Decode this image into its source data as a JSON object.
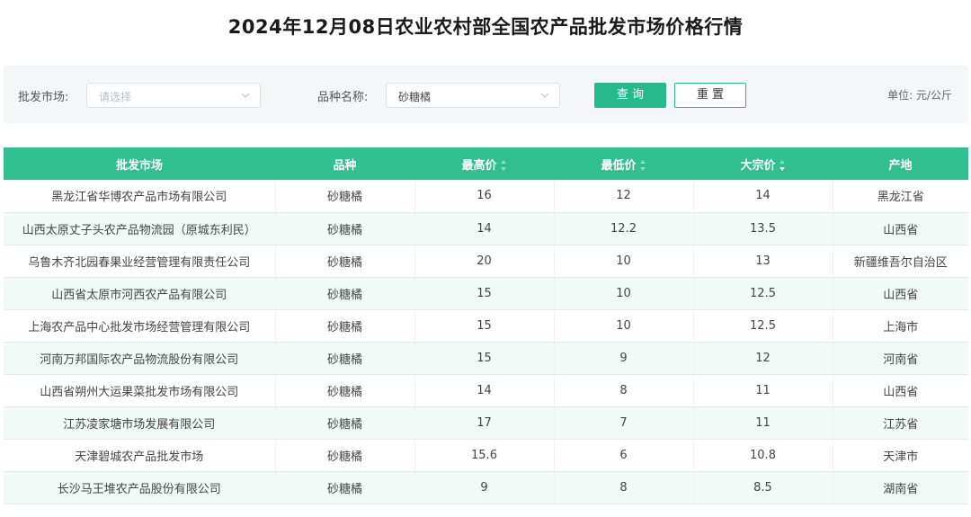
{
  "page": {
    "title": "2024年12月08日农业农村部全国农产品批发市场价格行情"
  },
  "filters": {
    "market_label": "批发市场:",
    "market_placeholder": "请选择",
    "variety_label": "品种名称:",
    "variety_value": "砂糖橘",
    "query_button": "查 询",
    "reset_button": "重 置",
    "unit": "单位: 元/公斤"
  },
  "colors": {
    "accent": "#31bf8f",
    "button_primary": "#26b98b",
    "row_stripe": "#f1faf6"
  },
  "table": {
    "columns": [
      {
        "label": "批发市场",
        "sortable": false
      },
      {
        "label": "品种",
        "sortable": false
      },
      {
        "label": "最高价",
        "sortable": true,
        "sort": "none"
      },
      {
        "label": "最低价",
        "sortable": true,
        "sort": "none"
      },
      {
        "label": "大宗价",
        "sortable": true,
        "sort": "desc"
      },
      {
        "label": "产地",
        "sortable": false
      }
    ],
    "rows": [
      [
        "黑龙江省华博农产品市场有限公司",
        "砂糖橘",
        "16",
        "12",
        "14",
        "黑龙江省"
      ],
      [
        "山西太原丈子头农产品物流园（原城东利民）",
        "砂糖橘",
        "14",
        "12.2",
        "13.5",
        "山西省"
      ],
      [
        "乌鲁木齐北园春果业经营管理有限责任公司",
        "砂糖橘",
        "20",
        "10",
        "13",
        "新疆维吾尔自治区"
      ],
      [
        "山西省太原市河西农产品有限公司",
        "砂糖橘",
        "15",
        "10",
        "12.5",
        "山西省"
      ],
      [
        "上海农产品中心批发市场经营管理有限公司",
        "砂糖橘",
        "15",
        "10",
        "12.5",
        "上海市"
      ],
      [
        "河南万邦国际农产品物流股份有限公司",
        "砂糖橘",
        "15",
        "9",
        "12",
        "河南省"
      ],
      [
        "山西省朔州大运果菜批发市场有限公司",
        "砂糖橘",
        "14",
        "8",
        "11",
        "山西省"
      ],
      [
        "江苏凌家塘市场发展有限公司",
        "砂糖橘",
        "17",
        "7",
        "11",
        "江苏省"
      ],
      [
        "天津碧城农产品批发市场",
        "砂糖橘",
        "15.6",
        "6",
        "10.8",
        "天津市"
      ],
      [
        "长沙马王堆农产品股份有限公司",
        "砂糖橘",
        "9",
        "8",
        "8.5",
        "湖南省"
      ]
    ]
  }
}
